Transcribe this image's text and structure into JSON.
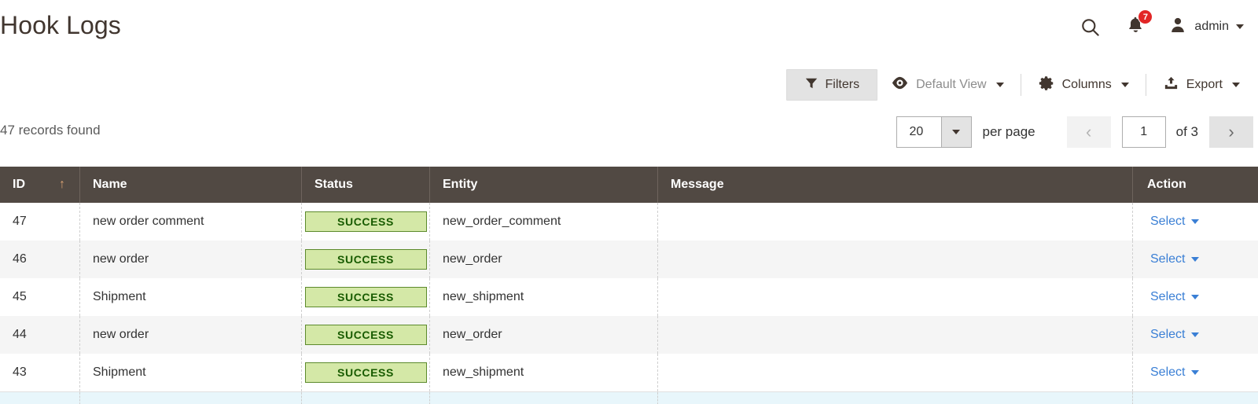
{
  "header": {
    "title": "Hook Logs",
    "search_icon": "search-icon",
    "notifications": {
      "icon": "bell-icon",
      "count": "7"
    },
    "user": {
      "icon": "user-avatar-icon",
      "name": "admin",
      "caret": "chevron-down-icon"
    }
  },
  "toolbar": {
    "filters": {
      "label": "Filters",
      "icon": "funnel-icon"
    },
    "view": {
      "label": "Default View",
      "icon": "eye-icon",
      "caret": "chevron-down-icon"
    },
    "columns": {
      "label": "Columns",
      "icon": "gear-icon",
      "caret": "chevron-down-icon"
    },
    "export": {
      "label": "Export",
      "icon": "upload-icon",
      "caret": "chevron-down-icon"
    }
  },
  "grid_meta": {
    "records_found": "47 records found",
    "per_page_value": "20",
    "per_page_label": "per page",
    "prev_glyph": "‹",
    "next_glyph": "›",
    "current_page": "1",
    "of_pages": "of 3"
  },
  "columns": [
    {
      "key": "id",
      "label": "ID",
      "sort": "↑"
    },
    {
      "key": "name",
      "label": "Name"
    },
    {
      "key": "status",
      "label": "Status"
    },
    {
      "key": "entity",
      "label": "Entity"
    },
    {
      "key": "message",
      "label": "Message"
    },
    {
      "key": "action",
      "label": "Action"
    }
  ],
  "rows": [
    {
      "id": "47",
      "name": "new order comment",
      "status": "SUCCESS",
      "entity": "new_order_comment",
      "message": "",
      "action": "Select"
    },
    {
      "id": "46",
      "name": "new order",
      "status": "SUCCESS",
      "entity": "new_order",
      "message": "",
      "action": "Select"
    },
    {
      "id": "45",
      "name": "Shipment",
      "status": "SUCCESS",
      "entity": "new_shipment",
      "message": "",
      "action": "Select"
    },
    {
      "id": "44",
      "name": "new order",
      "status": "SUCCESS",
      "entity": "new_order",
      "message": "",
      "action": "Select"
    },
    {
      "id": "43",
      "name": "Shipment",
      "status": "SUCCESS",
      "entity": "new_shipment",
      "message": "",
      "action": "Select"
    }
  ],
  "colors": {
    "header_bar": "#514943",
    "badge_bg": "#d4e8a7",
    "badge_border": "#5c8a2c",
    "badge_text": "#185b00",
    "link": "#3a7fd5",
    "badge_alert": "#e22626",
    "sort_arrow": "#d9a273",
    "row_alt": "#f5f5f5",
    "row_highlight": "#e8f6fb"
  }
}
